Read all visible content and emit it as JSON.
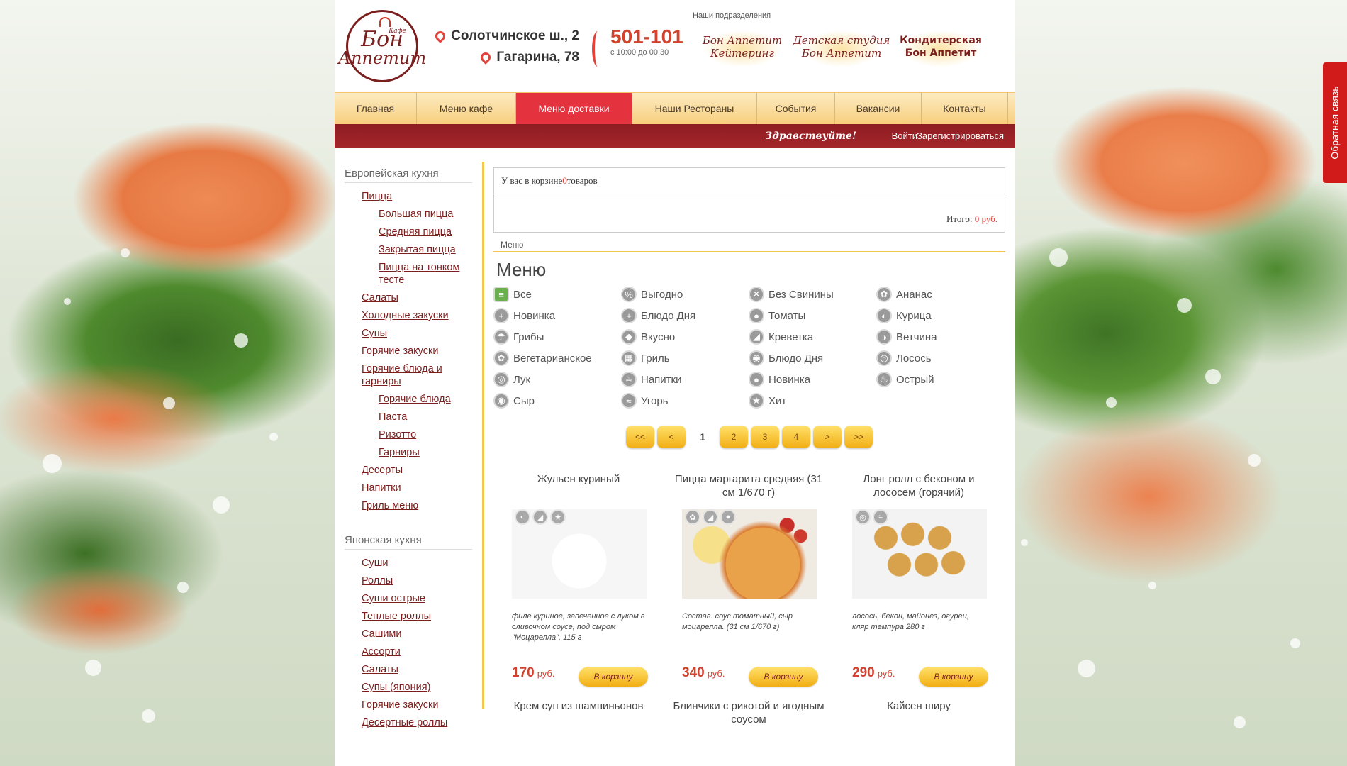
{
  "header": {
    "logo": {
      "line1": "Бон",
      "line2": "Аппетит",
      "cafe": "Кафе"
    },
    "addresses": [
      "Солотчинское ш., 2",
      "Гагарина, 78"
    ],
    "phone": "501-101",
    "hours": "с 10:00 до 00:30",
    "divisions_caption": "Наши подразделения",
    "divisions": [
      "Бон Аппетит Кейтеринг",
      "Детская студия Бон Аппетит",
      "Кондитерская Бон Аппетит"
    ]
  },
  "nav": {
    "items": [
      "Главная",
      "Меню кафе",
      "Меню доставки",
      "Наши Рестораны",
      "События",
      "Вакансии",
      "Контакты"
    ],
    "active": "Меню доставки"
  },
  "subbar": {
    "greeting": "Здравствуйте!",
    "login": "Войти",
    "register": "Зарегистрироваться"
  },
  "sidebar": {
    "european": {
      "title": "Европейская кухня",
      "items": [
        {
          "label": "Пицца",
          "level": 1
        },
        {
          "label": "Большая пицца",
          "level": 2
        },
        {
          "label": "Средняя пицца",
          "level": 2
        },
        {
          "label": "Закрытая пицца",
          "level": 2
        },
        {
          "label": "Пицца на тонком тесте",
          "level": 2
        },
        {
          "label": "Салаты",
          "level": 1
        },
        {
          "label": "Холодные закуски",
          "level": 1
        },
        {
          "label": "Супы",
          "level": 1
        },
        {
          "label": "Горячие закуски",
          "level": 1
        },
        {
          "label": "Горячие блюда и гарниры",
          "level": 1
        },
        {
          "label": "Горячие блюда",
          "level": 2
        },
        {
          "label": "Паста",
          "level": 2
        },
        {
          "label": "Ризотто",
          "level": 2
        },
        {
          "label": "Гарниры",
          "level": 2
        },
        {
          "label": "Десерты",
          "level": 1
        },
        {
          "label": "Напитки",
          "level": 1
        },
        {
          "label": "Гриль меню",
          "level": 1
        }
      ]
    },
    "japanese": {
      "title": "Японская кухня",
      "items": [
        "Суши",
        "Роллы",
        "Суши острые",
        "Теплые роллы",
        "Сашими",
        "Ассорти",
        "Салаты",
        "Супы (япония)",
        "Горячие закуски",
        "Десертные роллы"
      ]
    }
  },
  "cart": {
    "text_before": "У вас в корзине ",
    "count": "0",
    "text_after": " товаров",
    "total_label": "Итого: ",
    "total_value": "0 руб."
  },
  "breadcrumb": "Меню",
  "menu_title": "Меню",
  "filters": [
    "Все",
    "Выгодно",
    "Без Свинины",
    "Ананас",
    "Новинка",
    "Блюдо Дня",
    "Томаты",
    "Курица",
    "Грибы",
    "Вкусно",
    "Креветка",
    "Ветчина",
    "Вегетарианское",
    "Гриль",
    "Блюдо Дня",
    "Лосось",
    "Лук",
    "Напитки",
    "Новинка",
    "Острый",
    "Сыр",
    "Угорь",
    "Хит"
  ],
  "pager": {
    "first": "<<",
    "prev": "<",
    "current": "1",
    "pages": [
      "2",
      "3",
      "4"
    ],
    "next": ">",
    "last": ">>"
  },
  "products": [
    {
      "name": "Жульен куриный",
      "desc": "филе куриное, запеченное с луком в сливочном соусе, под сыром \"Моцарелла\". 115 г",
      "price": "170",
      "currency": "руб.",
      "button": "В корзину"
    },
    {
      "name": "Пицца маргарита средняя (31 см 1/670 г)",
      "desc": "Состав: соус томатный, сыр моцарелла. (31 см 1/670 г)",
      "price": "340",
      "currency": "руб.",
      "button": "В корзину"
    },
    {
      "name": "Лонг ролл с беконом и лососем (горячий)",
      "desc": "лосось, бекон, майонез, огурец, кляр темпура 280 г",
      "price": "290",
      "currency": "руб.",
      "button": "В корзину"
    }
  ],
  "products_next": [
    "Крем суп из шампиньонов",
    "Блинчики с рикотой и ягодным соусом",
    "Кайсен ширу"
  ],
  "feedback": "Обратная связь"
}
